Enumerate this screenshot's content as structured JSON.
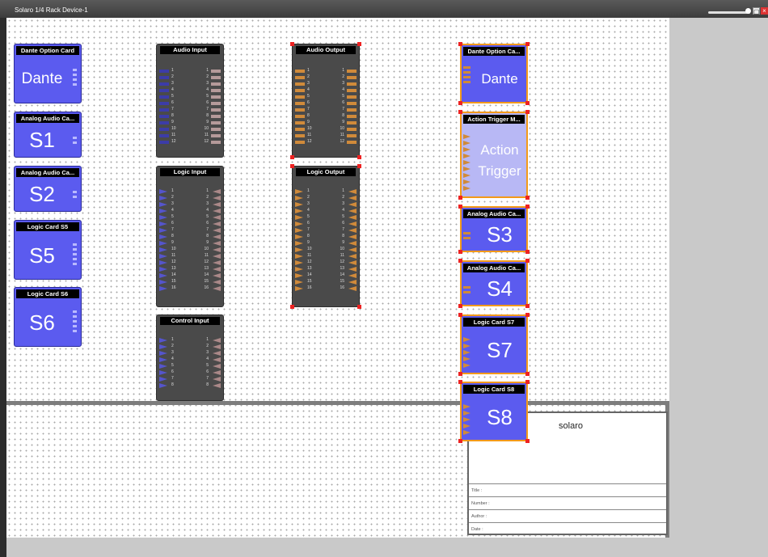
{
  "window": {
    "title": "Solaro 1/4 Rack Device-1",
    "restore_icon": "restore-icon",
    "close_icon": "close-icon",
    "zoom_icon": "zoom-slider"
  },
  "left_cards": [
    {
      "header": "Dante Option Card",
      "label": "Dante"
    },
    {
      "header": "Analog Audio Ca...",
      "label": "S1"
    },
    {
      "header": "Analog Audio Ca...",
      "label": "S2"
    },
    {
      "header": "Logic Card S5",
      "label": "S5"
    },
    {
      "header": "Logic Card S6",
      "label": "S6"
    }
  ],
  "audio_input": {
    "header": "Audio Input",
    "rows": [
      "1",
      "2",
      "3",
      "4",
      "5",
      "6",
      "7",
      "8",
      "9",
      "10",
      "11",
      "12"
    ]
  },
  "logic_input": {
    "header": "Logic Input",
    "rows": [
      "1",
      "2",
      "3",
      "4",
      "5",
      "6",
      "7",
      "8",
      "9",
      "10",
      "11",
      "12",
      "13",
      "14",
      "15",
      "16"
    ]
  },
  "control_input": {
    "header": "Control Input",
    "rows": [
      "1",
      "2",
      "3",
      "4",
      "5",
      "6",
      "7",
      "8"
    ]
  },
  "audio_output": {
    "header": "Audio Output",
    "rows": [
      "1",
      "2",
      "3",
      "4",
      "5",
      "6",
      "7",
      "8",
      "9",
      "10",
      "11",
      "12"
    ]
  },
  "logic_output": {
    "header": "Logic Output",
    "rows": [
      "1",
      "2",
      "3",
      "4",
      "5",
      "6",
      "7",
      "8",
      "9",
      "10",
      "11",
      "12",
      "13",
      "14",
      "15",
      "16"
    ]
  },
  "right_cards": [
    {
      "header": "Dante Option Ca...",
      "label": "Dante"
    },
    {
      "header": "Action Trigger M...",
      "label_line1": "Action",
      "label_line2": "Trigger"
    },
    {
      "header": "Analog Audio Ca...",
      "label": "S3"
    },
    {
      "header": "Analog Audio Ca...",
      "label": "S4"
    },
    {
      "header": "Logic Card S7",
      "label": "S7"
    },
    {
      "header": "Logic Card S8",
      "label": "S8"
    }
  ],
  "title_block": {
    "name": "solaro",
    "fields": [
      "Title :",
      "Number :",
      "Author :",
      "Date :"
    ]
  },
  "colors": {
    "card_blue": "#5b5bef",
    "selection_orange": "#f39a1a",
    "handle_red": "#e22222",
    "io_gray": "#4a4a4a"
  }
}
